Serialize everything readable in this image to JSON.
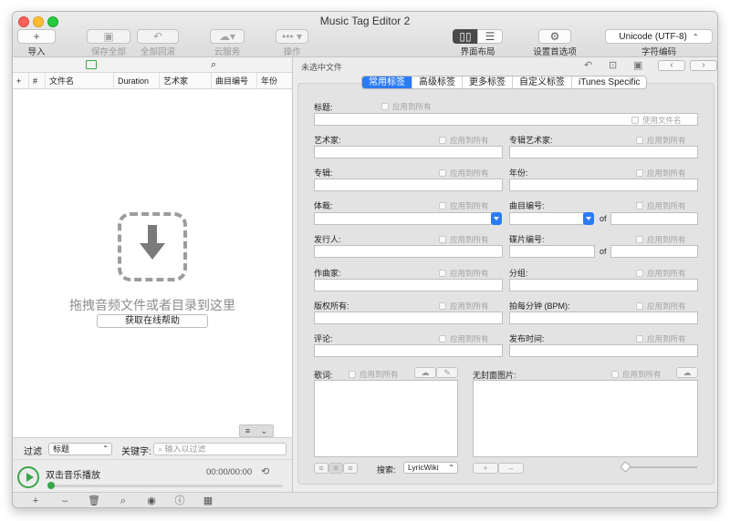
{
  "window": {
    "title": "Music Tag Editor 2"
  },
  "toolbar": {
    "import_label": "导入",
    "save_all_label": "保存全部",
    "revert_all_label": "全部回滚",
    "cloud_label": "云服务",
    "action_label": "操作",
    "layout_label": "界面布局",
    "prefs_label": "设置首选项",
    "encoding_value": "Unicode (UTF-8)",
    "encoding_label": "字符编码"
  },
  "file_list": {
    "columns": [
      "+",
      "#",
      "文件名",
      "Duration",
      "艺术家",
      "曲目编号",
      "年份"
    ],
    "drop_hint": "拖拽音频文件或者目录到这里",
    "help_button": "获取在线帮助"
  },
  "filter": {
    "label": "过滤",
    "selected": "标题",
    "keyword_label": "关键字:",
    "keyword_placeholder": "输入以过滤"
  },
  "player": {
    "title": "双击音乐播放",
    "time": "00:00/00:00",
    "progress": 0
  },
  "editor": {
    "selection_status": "未选中文件",
    "tabs": [
      "常用标签",
      "高级标签",
      "更多标签",
      "自定义标签",
      "iTunes Specific"
    ],
    "active_tab": 0,
    "apply_all": "应用到所有",
    "use_filename": "使用文件名",
    "of_label": "of",
    "fields": {
      "title": "标题:",
      "artist": "艺术家:",
      "album_artist": "专辑艺术家:",
      "album": "专辑:",
      "year": "年份:",
      "genre": "体裁:",
      "track": "曲目编号:",
      "publisher": "发行人:",
      "disc": "碟片编号:",
      "composer": "作曲家:",
      "grouping": "分组:",
      "copyright": "版权所有:",
      "bpm": "拍每分钟 (BPM):",
      "comment": "评论:",
      "release_date": "发布时间:",
      "lyrics": "歌词:",
      "cover": "无封面图片:"
    },
    "lyrics_search_label": "搜索:",
    "lyrics_search_value": "LyricWiki"
  },
  "colors": {
    "accent": "#2a7bf5",
    "play_green": "#3aa64a"
  }
}
